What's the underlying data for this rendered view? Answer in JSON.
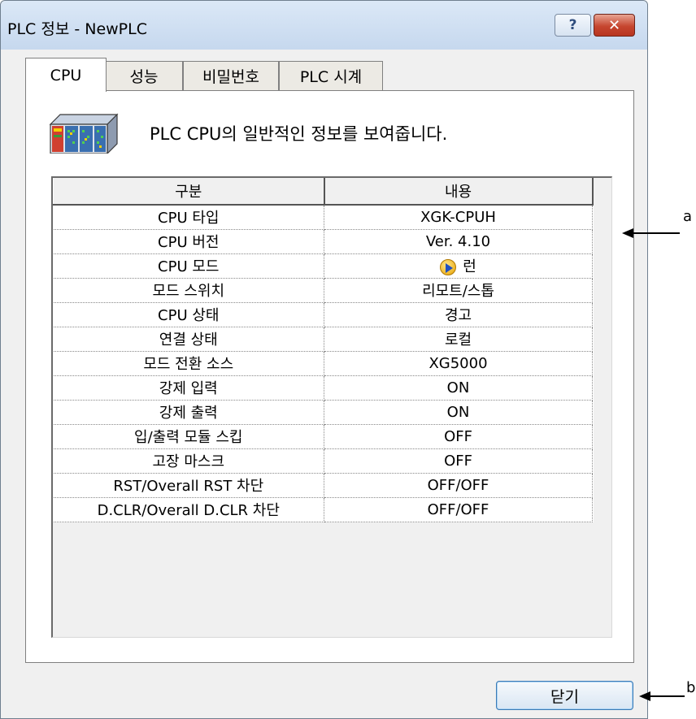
{
  "window": {
    "title": "PLC 정보 - NewPLC",
    "help_glyph": "?",
    "close_glyph": "✕"
  },
  "tabs": [
    {
      "label": "CPU",
      "active": true
    },
    {
      "label": "성능",
      "active": false
    },
    {
      "label": "비밀번호",
      "active": false
    },
    {
      "label": "PLC 시계",
      "active": false
    }
  ],
  "panel": {
    "icon": "plc-cpu-icon",
    "description": "PLC CPU의 일반적인 정보를 보여줍니다."
  },
  "table": {
    "headers": [
      "구분",
      "내용"
    ],
    "rows": [
      [
        "CPU 타입",
        "XGK-CPUH"
      ],
      [
        "CPU 버전",
        "Ver. 4.10"
      ],
      [
        "CPU 모드",
        "런"
      ],
      [
        "모드 스위치",
        "리모트/스톱"
      ],
      [
        "CPU 상태",
        "경고"
      ],
      [
        "연결 상태",
        "로컬"
      ],
      [
        "모드 전환 소스",
        "XG5000"
      ],
      [
        "강제 입력",
        "ON"
      ],
      [
        "강제 출력",
        "ON"
      ],
      [
        "입/출력 모듈 스킵",
        "OFF"
      ],
      [
        "고장 마스크",
        "OFF"
      ],
      [
        "RST/Overall RST 차단",
        "OFF/OFF"
      ],
      [
        "D.CLR/Overall D.CLR 차단",
        "OFF/OFF"
      ]
    ],
    "run_icon": "run-play-icon"
  },
  "buttons": {
    "close_label": "닫기"
  },
  "annotations": {
    "a": "a",
    "b": "b"
  },
  "colors": {
    "titlebar": "#c6d8ee",
    "close_red": "#c6462f",
    "dialog_bg": "#f0f0f0"
  }
}
